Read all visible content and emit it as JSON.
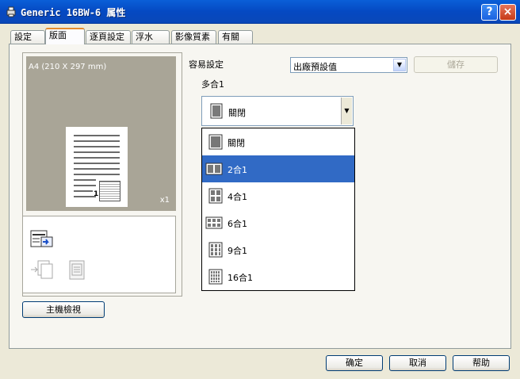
{
  "window": {
    "title": "Generic 16BW-6 属性",
    "help_label": "?",
    "close_label": "×"
  },
  "tabs": [
    {
      "label": "設定"
    },
    {
      "label": "版面"
    },
    {
      "label": "逐頁設定"
    },
    {
      "label": "浮水"
    },
    {
      "label": "影像質素"
    },
    {
      "label": "有關"
    }
  ],
  "preview": {
    "paper_label": "A4  (210 X 297 mm)",
    "copies_label": "x1",
    "page_number": "1"
  },
  "host_view_label": "主機檢視",
  "easy_settings": {
    "label": "容易設定",
    "selected": "出廠預設值",
    "save_label": "儲存"
  },
  "nup": {
    "label": "多合1",
    "selected": "關閉",
    "options": [
      {
        "label": "關閉",
        "icon": "page-1up-icon"
      },
      {
        "label": "2合1",
        "icon": "page-2up-icon"
      },
      {
        "label": "4合1",
        "icon": "page-4up-icon"
      },
      {
        "label": "6合1",
        "icon": "page-6up-icon"
      },
      {
        "label": "9合1",
        "icon": "page-9up-icon"
      },
      {
        "label": "16合1",
        "icon": "page-16up-icon"
      }
    ],
    "highlighted_index": 1
  },
  "footer": {
    "ok_label": "确定",
    "cancel_label": "取消",
    "help_label": "帮助"
  }
}
